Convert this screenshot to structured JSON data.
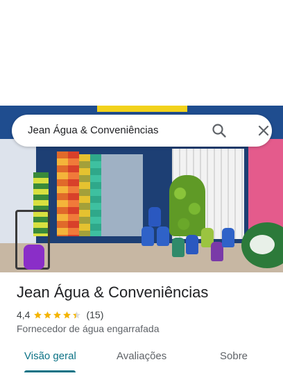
{
  "search": {
    "query": "Jean Água & Conveniências",
    "search_icon": "search-icon",
    "close_icon": "close-icon"
  },
  "place": {
    "name": "Jean Água & Conveniências",
    "rating": "4,4",
    "rating_stars": 4.4,
    "reviews": "(15)",
    "category": "Fornecedor de água engarrafada"
  },
  "tabs": [
    {
      "label": "Visão geral",
      "active": true
    },
    {
      "label": "Avaliações",
      "active": false
    },
    {
      "label": "Sobre",
      "active": false
    }
  ],
  "colors": {
    "accent": "#0b7285",
    "star": "#f4b400",
    "text_primary": "#202124",
    "text_secondary": "#5f6368"
  }
}
